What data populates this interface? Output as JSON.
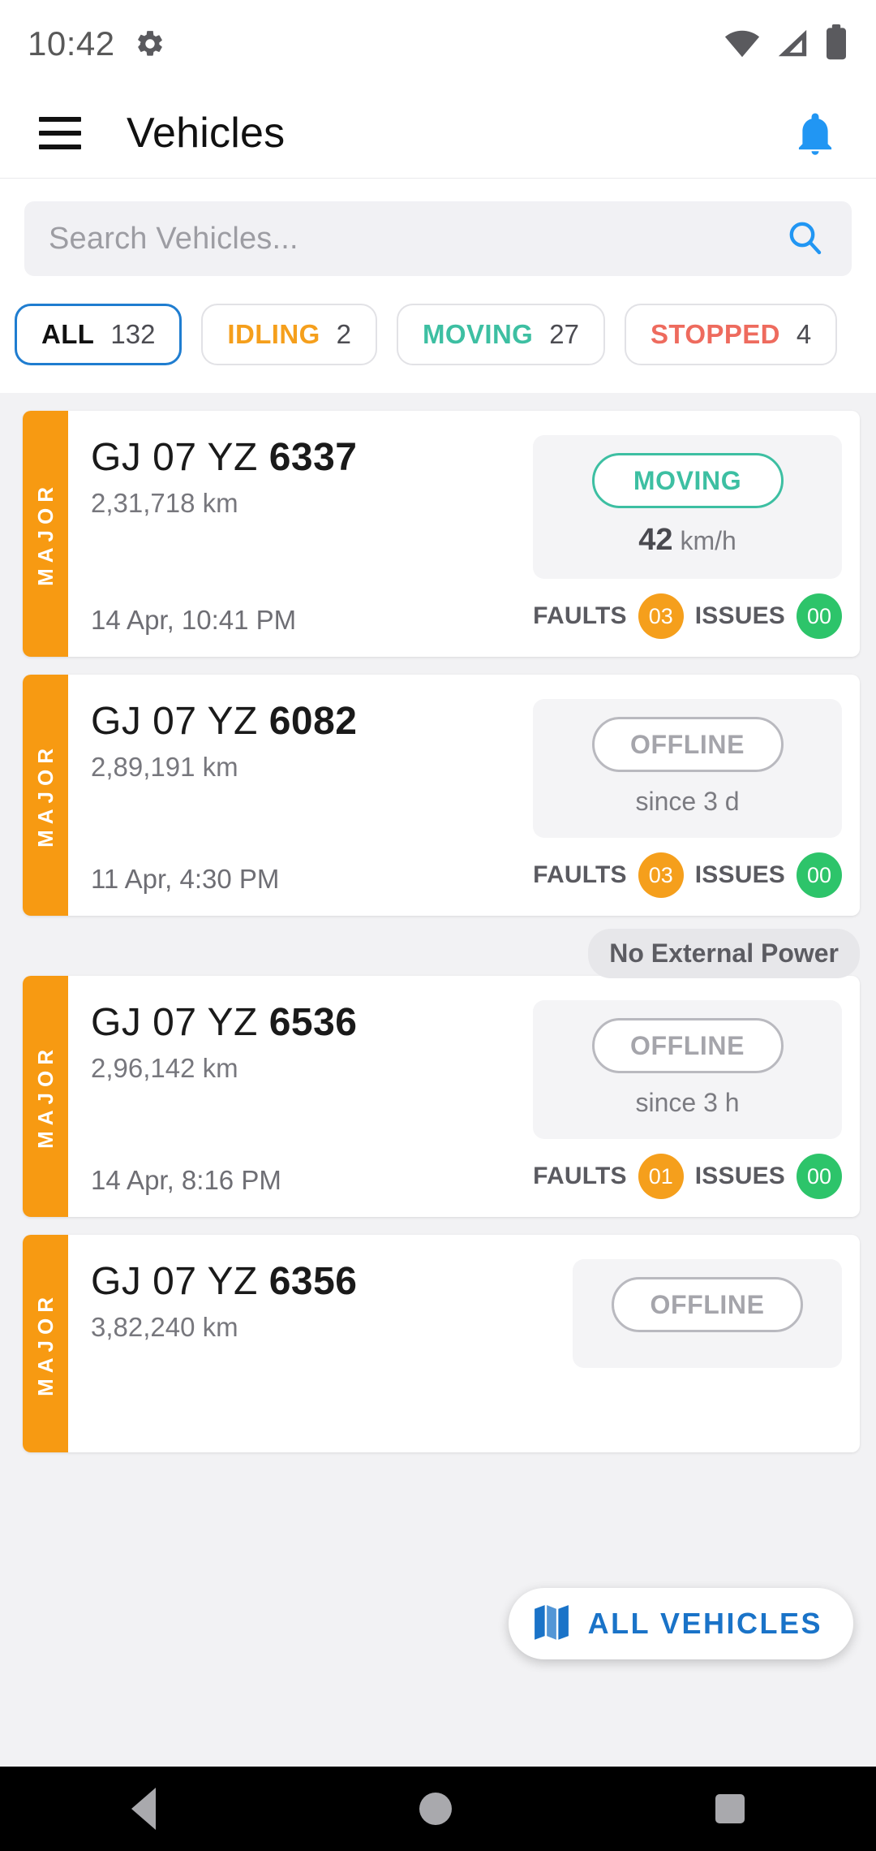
{
  "statusbar": {
    "time": "10:42",
    "icons": [
      "gear-icon",
      "wifi-icon",
      "cellular-icon",
      "battery-icon"
    ]
  },
  "appbar": {
    "menu_icon": "hamburger-menu-icon",
    "title": "Vehicles",
    "notification_icon": "bell-icon",
    "notification_color": "#2196F3"
  },
  "search": {
    "placeholder": "Search Vehicles...",
    "icon": "search-icon",
    "icon_color": "#2196F3"
  },
  "filters": [
    {
      "label": "ALL",
      "count": "132",
      "color": "#111111",
      "selected": true
    },
    {
      "label": "IDLING",
      "count": "2",
      "color": "#F59F1C",
      "selected": false
    },
    {
      "label": "MOVING",
      "count": "27",
      "color": "#3DBFA2",
      "selected": false
    },
    {
      "label": "STOPPED",
      "count": "4",
      "color": "#EE6B5E",
      "selected": false
    }
  ],
  "vehicles": [
    {
      "severity": "MAJOR",
      "severity_color": "#F79A12",
      "plate_prefix": "GJ 07 YZ ",
      "plate_number": "6337",
      "odometer": "2,31,718 km",
      "timestamp": "14 Apr, 10:41 PM",
      "status": "MOVING",
      "status_color": "#3DBFA2",
      "speed_value": "42",
      "speed_unit": "km/h",
      "faults_label": "FAULTS",
      "faults_count": "03",
      "issues_label": "ISSUES",
      "issues_count": "00",
      "power_tag": null
    },
    {
      "severity": "MAJOR",
      "severity_color": "#F79A12",
      "plate_prefix": "GJ 07 YZ ",
      "plate_number": "6082",
      "odometer": "2,89,191 km",
      "timestamp": "11 Apr, 4:30 PM",
      "status": "OFFLINE",
      "status_color": "#A5A5AB",
      "since": "since 3 d",
      "faults_label": "FAULTS",
      "faults_count": "03",
      "issues_label": "ISSUES",
      "issues_count": "00",
      "power_tag": null
    },
    {
      "severity": "MAJOR",
      "severity_color": "#F79A12",
      "plate_prefix": "GJ 07 YZ ",
      "plate_number": "6536",
      "odometer": "2,96,142 km",
      "timestamp": "14 Apr, 8:16 PM",
      "status": "OFFLINE",
      "status_color": "#A5A5AB",
      "since": "since 3 h",
      "faults_label": "FAULTS",
      "faults_count": "01",
      "issues_label": "ISSUES",
      "issues_count": "00",
      "power_tag": "No External Power"
    },
    {
      "severity": "MAJOR",
      "severity_color": "#F79A12",
      "plate_prefix": "GJ 07 YZ ",
      "plate_number": "6356",
      "odometer": "3,82,240 km",
      "timestamp": "",
      "status": "OFFLINE",
      "status_color": "#A5A5AB",
      "since": "",
      "faults_label": "",
      "faults_count": "",
      "issues_label": "",
      "issues_count": "",
      "power_tag": null
    }
  ],
  "fab": {
    "label": "ALL VEHICLES",
    "icon": "map-icon",
    "color": "#1A73C8"
  },
  "navbar": {
    "back": "back-triangle-icon",
    "home": "home-circle-icon",
    "recents": "recents-square-icon"
  }
}
